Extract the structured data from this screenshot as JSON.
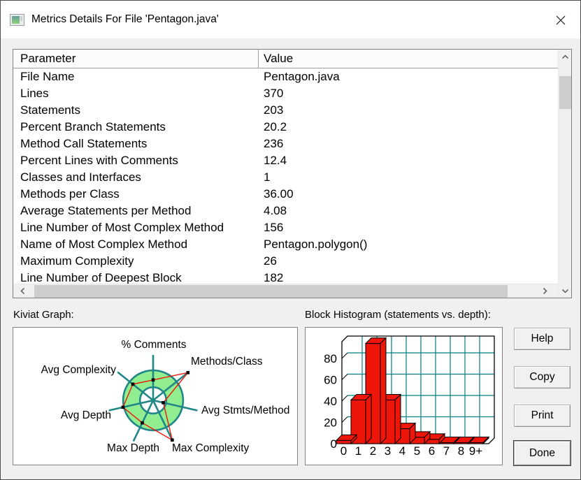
{
  "window": {
    "title": "Metrics Details For File 'Pentagon.java'"
  },
  "table": {
    "columns": [
      "Parameter",
      "Value"
    ],
    "rows": [
      {
        "parameter": "File Name",
        "value": "Pentagon.java"
      },
      {
        "parameter": "Lines",
        "value": "370"
      },
      {
        "parameter": "Statements",
        "value": "203"
      },
      {
        "parameter": "Percent Branch Statements",
        "value": "20.2"
      },
      {
        "parameter": "Method Call Statements",
        "value": "236"
      },
      {
        "parameter": "Percent Lines with Comments",
        "value": "12.4"
      },
      {
        "parameter": "Classes and Interfaces",
        "value": "1"
      },
      {
        "parameter": "Methods per Class",
        "value": "36.00"
      },
      {
        "parameter": "Average Statements per Method",
        "value": "4.08"
      },
      {
        "parameter": "Line Number of Most Complex Method",
        "value": "156"
      },
      {
        "parameter": "Name of Most Complex Method",
        "value": "Pentagon.polygon()"
      },
      {
        "parameter": "Maximum Complexity",
        "value": "26"
      },
      {
        "parameter": "Line Number of Deepest Block",
        "value": "182"
      }
    ]
  },
  "kiviat": {
    "label": "Kiviat Graph:",
    "chart_data": {
      "type": "radar",
      "axes": [
        "% Comments",
        "Methods/Class",
        "Avg Stmts/Method",
        "Max Complexity",
        "Max Depth",
        "Avg Depth",
        "Avg Complexity"
      ],
      "values_fraction_of_axis": [
        0.45,
        0.98,
        0.23,
        0.97,
        0.55,
        0.68,
        0.57
      ],
      "normal_band": {
        "inner": 0.29,
        "outer": 0.66
      },
      "colors": {
        "band": "#90ee90",
        "spokes": "#218686",
        "series": "#ee1509",
        "marker": "#000000"
      }
    }
  },
  "histogram": {
    "label": "Block Histogram (statements vs. depth):",
    "chart_data": {
      "type": "bar",
      "categories": [
        "0",
        "1",
        "2",
        "3",
        "4",
        "5",
        "6",
        "7",
        "8",
        "9+"
      ],
      "values": [
        3,
        41,
        94,
        41,
        14,
        6,
        4,
        1,
        1,
        1
      ],
      "yticks": [
        0,
        20,
        40,
        60,
        80
      ],
      "ylim": [
        0,
        96
      ],
      "grid": true,
      "colors": {
        "bar": "#ee1509",
        "grid": "#008080",
        "frame": "#000000"
      }
    }
  },
  "buttons": [
    {
      "label": "Help"
    },
    {
      "label": "Copy"
    },
    {
      "label": "Print"
    },
    {
      "label": "Done"
    }
  ]
}
